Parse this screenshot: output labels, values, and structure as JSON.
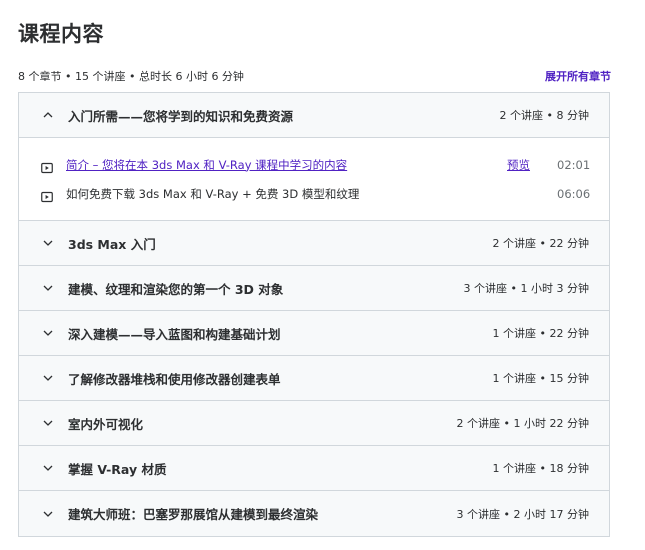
{
  "heading": "课程内容",
  "summary": "8 个章节 • 15 个讲座 • 总时长 6 小时 6 分钟",
  "expand_all_label": "展开所有章节",
  "sections": [
    {
      "title": "入门所需——您将学到的知识和免费资源",
      "meta": "2 个讲座 • 8 分钟",
      "expanded": true,
      "lectures": [
        {
          "title": "简介 – 您将在本 3ds Max 和 V-Ray 课程中学习的内容",
          "preview": "预览",
          "duration": "02:01"
        },
        {
          "title": "如何免费下载 3ds Max 和 V-Ray + 免费 3D 模型和纹理",
          "preview": "",
          "duration": "06:06"
        }
      ]
    },
    {
      "title": "3ds Max 入门",
      "meta": "2 个讲座 • 22 分钟",
      "expanded": false
    },
    {
      "title": "建模、纹理和渲染您的第一个 3D 对象",
      "meta": "3 个讲座 • 1 小时 3 分钟",
      "expanded": false
    },
    {
      "title": "深入建模——导入蓝图和构建基础计划",
      "meta": "1 个讲座 • 22 分钟",
      "expanded": false
    },
    {
      "title": "了解修改器堆栈和使用修改器创建表单",
      "meta": "1 个讲座 • 15 分钟",
      "expanded": false
    },
    {
      "title": "室内外可视化",
      "meta": "2 个讲座 • 1 小时 22 分钟",
      "expanded": false
    },
    {
      "title": "掌握 V-Ray 材质",
      "meta": "1 个讲座 • 18 分钟",
      "expanded": false
    },
    {
      "title": "建筑大师班：巴塞罗那展馆从建模到最终渲染",
      "meta": "3 个讲座 • 2 小时 17 分钟",
      "expanded": false
    }
  ],
  "icons": {
    "expanded": "chevron-up-icon",
    "collapsed": "chevron-down-icon",
    "lecture": "video-play-icon"
  },
  "colors": {
    "accent": "#5022c3",
    "border": "#d1d7dc",
    "header_bg": "#f7f9fa",
    "text": "#2d2f31"
  }
}
